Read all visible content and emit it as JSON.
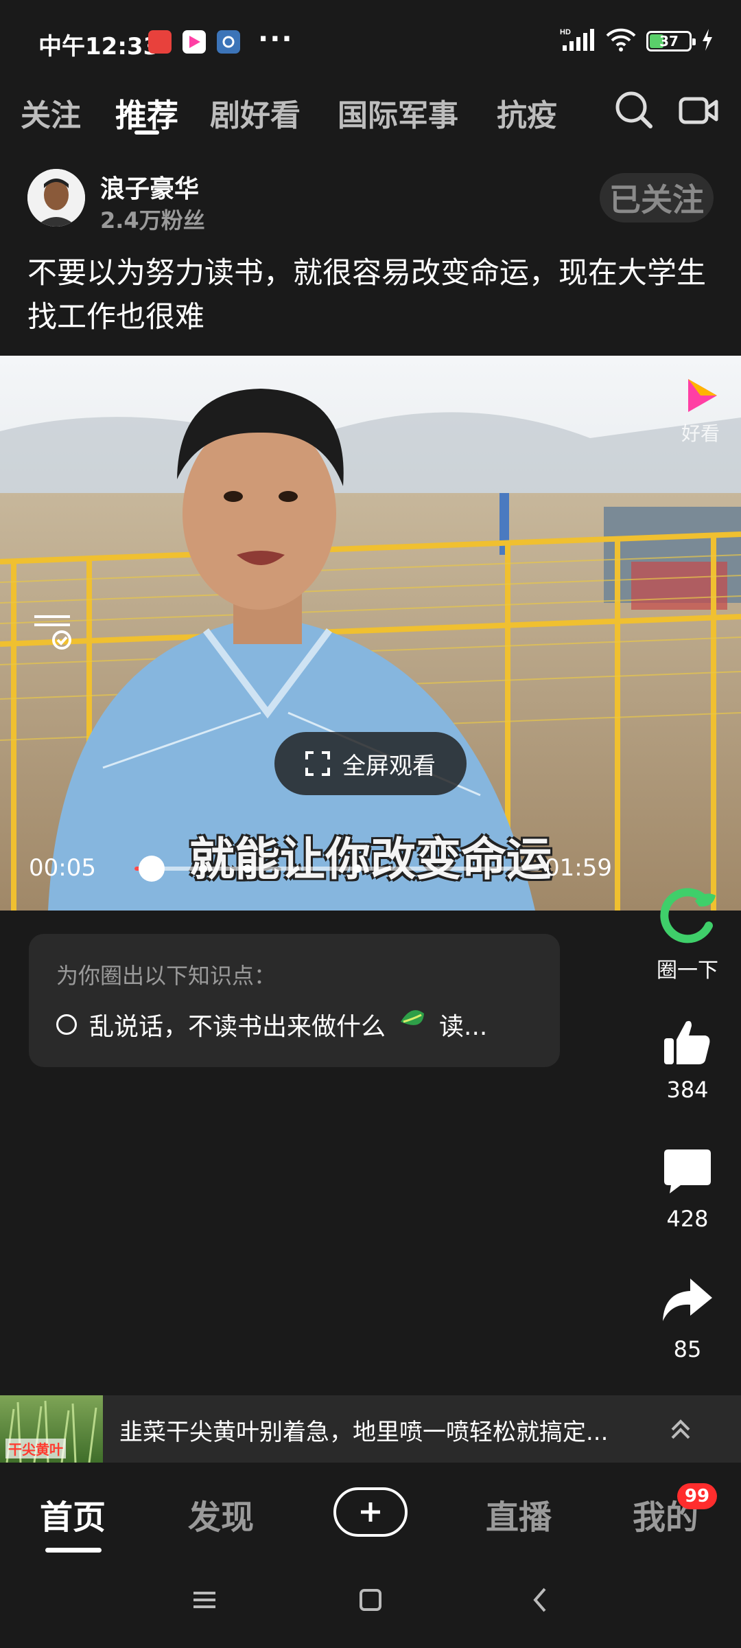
{
  "status_bar": {
    "time": "中午12:33",
    "more": "···",
    "battery_level": "37",
    "network_label": "HD"
  },
  "top_tabs": {
    "items": [
      "关注",
      "推荐",
      "剧好看",
      "国际军事",
      "抗疫"
    ],
    "active_index": 1
  },
  "author": {
    "name": "浪子豪华",
    "fans": "2.4万粉丝",
    "follow_label": "已关注"
  },
  "post": {
    "title": "不要以为努力读书，就很容易改变命运，现在大学生找工作也很难"
  },
  "video": {
    "subtitle": "就能让你改变命运",
    "fullscreen_label": "全屏观看",
    "current_time": "00:05",
    "duration": "01:59",
    "progress_fraction": 0.042,
    "logo_label": "好看"
  },
  "knowledge_card": {
    "title": "为你圈出以下知识点：",
    "point": "乱说话，不读书出来做什么",
    "point2": "读..."
  },
  "actions": {
    "circle_label": "圈一下",
    "likes": "384",
    "comments": "428",
    "shares": "85"
  },
  "ad": {
    "text": "韭菜干尖黄叶别着急，地里喷一喷轻松就搞定...",
    "thumb_label": "干尖黄叶"
  },
  "bottom_nav": {
    "items": [
      "首页",
      "发现",
      "直播",
      "我的"
    ],
    "active_index": 0,
    "badge": "99"
  },
  "colors": {
    "background": "#1a1a1a",
    "accent_red": "#ff2d2d",
    "card": "#2a2a2a"
  }
}
